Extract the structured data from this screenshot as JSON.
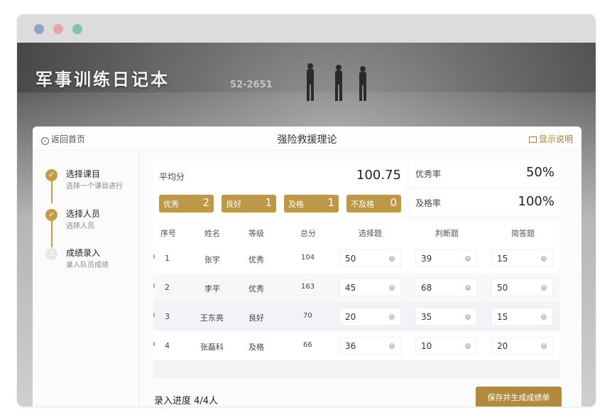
{
  "app": {
    "title": "军事训练日记本",
    "watermark": "52-2651"
  },
  "header": {
    "back_label": "返回首页",
    "page_title": "强险救援理论",
    "help_label": "显示说明"
  },
  "steps": [
    {
      "title": "选择课目",
      "subtitle": "选择一个课目进行",
      "status": "done"
    },
    {
      "title": "选择人员",
      "subtitle": "选择人员",
      "status": "done"
    },
    {
      "title": "成绩录入",
      "subtitle": "录入队员成绩",
      "status": "current",
      "number": "3"
    }
  ],
  "stats": {
    "avg_label": "平均分",
    "avg_value": "100.75",
    "grades": [
      {
        "label": "优秀",
        "count": "2"
      },
      {
        "label": "良好",
        "count": "1"
      },
      {
        "label": "及格",
        "count": "1"
      },
      {
        "label": "不及格",
        "count": "0"
      }
    ],
    "excellent_rate_label": "优秀率",
    "excellent_rate_value": "50%",
    "pass_rate_label": "及格率",
    "pass_rate_value": "100%"
  },
  "table": {
    "columns": [
      "序号",
      "姓名",
      "等级",
      "总分",
      "选择题",
      "判断题",
      "简答题"
    ],
    "rows": [
      {
        "no": "1",
        "name": "张宇",
        "level": "优秀",
        "total": "104",
        "choice": "50",
        "judge": "39",
        "short": "15"
      },
      {
        "no": "2",
        "name": "李平",
        "level": "优秀",
        "total": "163",
        "choice": "45",
        "judge": "68",
        "short": "50"
      },
      {
        "no": "3",
        "name": "王东亮",
        "level": "良好",
        "total": "70",
        "choice": "20",
        "judge": "35",
        "short": "15"
      },
      {
        "no": "4",
        "name": "张磊科",
        "level": "及格",
        "total": "66",
        "choice": "36",
        "judge": "10",
        "short": "20"
      }
    ]
  },
  "footer": {
    "progress_text": "录入进度 4/4人",
    "save_label": "保存并生成成绩单"
  },
  "colors": {
    "accent": "#b08a3e",
    "gold": "#c59b46"
  }
}
